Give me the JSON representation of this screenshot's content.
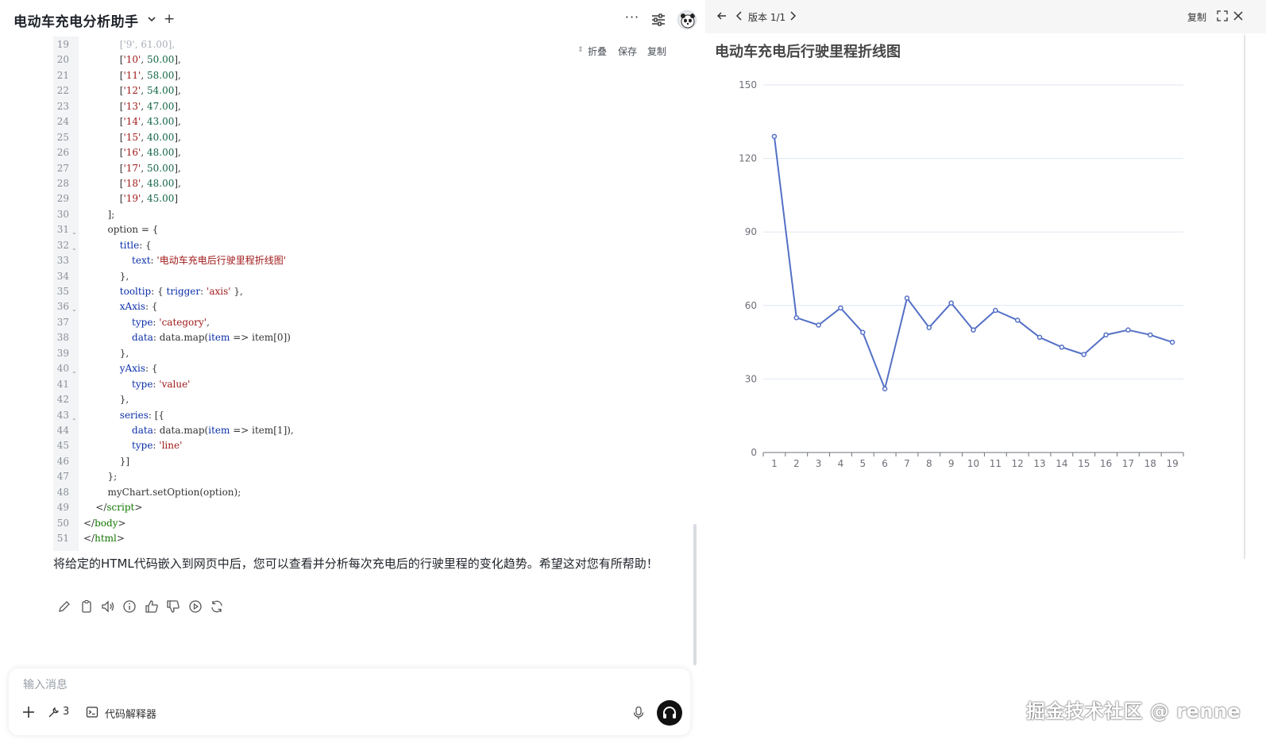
{
  "app": {
    "title": "电动车充电分析助手",
    "new_chat_label": "+",
    "more_label": "···"
  },
  "code_block": {
    "actions": {
      "fold": "折叠",
      "save": "保存",
      "copy": "复制"
    },
    "lines": [
      {
        "n": "19",
        "fold": false,
        "tokens": [
          [
            "c",
            "            ['9', 61.00],"
          ]
        ]
      },
      {
        "n": "20",
        "fold": false,
        "tokens": [
          [
            "p",
            "            ["
          ],
          [
            "s",
            "'10'"
          ],
          [
            "p",
            ", "
          ],
          [
            "n",
            "50.00"
          ],
          [
            "p",
            "],"
          ]
        ]
      },
      {
        "n": "21",
        "fold": false,
        "tokens": [
          [
            "p",
            "            ["
          ],
          [
            "s",
            "'11'"
          ],
          [
            "p",
            ", "
          ],
          [
            "n",
            "58.00"
          ],
          [
            "p",
            "],"
          ]
        ]
      },
      {
        "n": "22",
        "fold": false,
        "tokens": [
          [
            "p",
            "            ["
          ],
          [
            "s",
            "'12'"
          ],
          [
            "p",
            ", "
          ],
          [
            "n",
            "54.00"
          ],
          [
            "p",
            "],"
          ]
        ]
      },
      {
        "n": "23",
        "fold": false,
        "tokens": [
          [
            "p",
            "            ["
          ],
          [
            "s",
            "'13'"
          ],
          [
            "p",
            ", "
          ],
          [
            "n",
            "47.00"
          ],
          [
            "p",
            "],"
          ]
        ]
      },
      {
        "n": "24",
        "fold": false,
        "tokens": [
          [
            "p",
            "            ["
          ],
          [
            "s",
            "'14'"
          ],
          [
            "p",
            ", "
          ],
          [
            "n",
            "43.00"
          ],
          [
            "p",
            "],"
          ]
        ]
      },
      {
        "n": "25",
        "fold": false,
        "tokens": [
          [
            "p",
            "            ["
          ],
          [
            "s",
            "'15'"
          ],
          [
            "p",
            ", "
          ],
          [
            "n",
            "40.00"
          ],
          [
            "p",
            "],"
          ]
        ]
      },
      {
        "n": "26",
        "fold": false,
        "tokens": [
          [
            "p",
            "            ["
          ],
          [
            "s",
            "'16'"
          ],
          [
            "p",
            ", "
          ],
          [
            "n",
            "48.00"
          ],
          [
            "p",
            "],"
          ]
        ]
      },
      {
        "n": "27",
        "fold": false,
        "tokens": [
          [
            "p",
            "            ["
          ],
          [
            "s",
            "'17'"
          ],
          [
            "p",
            ", "
          ],
          [
            "n",
            "50.00"
          ],
          [
            "p",
            "],"
          ]
        ]
      },
      {
        "n": "28",
        "fold": false,
        "tokens": [
          [
            "p",
            "            ["
          ],
          [
            "s",
            "'18'"
          ],
          [
            "p",
            ", "
          ],
          [
            "n",
            "48.00"
          ],
          [
            "p",
            "],"
          ]
        ]
      },
      {
        "n": "29",
        "fold": false,
        "tokens": [
          [
            "p",
            "            ["
          ],
          [
            "s",
            "'19'"
          ],
          [
            "p",
            ", "
          ],
          [
            "n",
            "45.00"
          ],
          [
            "p",
            "]"
          ]
        ]
      },
      {
        "n": "30",
        "fold": false,
        "tokens": [
          [
            "p",
            "        ];"
          ]
        ]
      },
      {
        "n": "31",
        "fold": true,
        "tokens": [
          [
            "p",
            "        option = {"
          ]
        ]
      },
      {
        "n": "32",
        "fold": true,
        "tokens": [
          [
            "p",
            "            "
          ],
          [
            "k",
            "title"
          ],
          [
            "p",
            ": {"
          ]
        ]
      },
      {
        "n": "33",
        "fold": false,
        "tokens": [
          [
            "p",
            "                "
          ],
          [
            "k",
            "text"
          ],
          [
            "p",
            ": "
          ],
          [
            "s",
            "'电动车充电后行驶里程折线图'"
          ]
        ]
      },
      {
        "n": "34",
        "fold": false,
        "tokens": [
          [
            "p",
            "            },"
          ]
        ]
      },
      {
        "n": "35",
        "fold": false,
        "tokens": [
          [
            "p",
            "            "
          ],
          [
            "k",
            "tooltip"
          ],
          [
            "p",
            ": { "
          ],
          [
            "k",
            "trigger"
          ],
          [
            "p",
            ": "
          ],
          [
            "s",
            "'axis'"
          ],
          [
            "p",
            " },"
          ]
        ]
      },
      {
        "n": "36",
        "fold": true,
        "tokens": [
          [
            "p",
            "            "
          ],
          [
            "k",
            "xAxis"
          ],
          [
            "p",
            ": {"
          ]
        ]
      },
      {
        "n": "37",
        "fold": false,
        "tokens": [
          [
            "p",
            "                "
          ],
          [
            "k",
            "type"
          ],
          [
            "p",
            ": "
          ],
          [
            "s",
            "'category'"
          ],
          [
            "p",
            ","
          ]
        ]
      },
      {
        "n": "38",
        "fold": false,
        "tokens": [
          [
            "p",
            "                "
          ],
          [
            "k",
            "data"
          ],
          [
            "p",
            ": data.map("
          ],
          [
            "k",
            "item"
          ],
          [
            "p",
            " => item[0])"
          ]
        ]
      },
      {
        "n": "39",
        "fold": false,
        "tokens": [
          [
            "p",
            "            },"
          ]
        ]
      },
      {
        "n": "40",
        "fold": true,
        "tokens": [
          [
            "p",
            "            "
          ],
          [
            "k",
            "yAxis"
          ],
          [
            "p",
            ": {"
          ]
        ]
      },
      {
        "n": "41",
        "fold": false,
        "tokens": [
          [
            "p",
            "                "
          ],
          [
            "k",
            "type"
          ],
          [
            "p",
            ": "
          ],
          [
            "s",
            "'value'"
          ]
        ]
      },
      {
        "n": "42",
        "fold": false,
        "tokens": [
          [
            "p",
            "            },"
          ]
        ]
      },
      {
        "n": "43",
        "fold": true,
        "tokens": [
          [
            "p",
            "            "
          ],
          [
            "k",
            "series"
          ],
          [
            "p",
            ": [{"
          ]
        ]
      },
      {
        "n": "44",
        "fold": false,
        "tokens": [
          [
            "p",
            "                "
          ],
          [
            "k",
            "data"
          ],
          [
            "p",
            ": data.map("
          ],
          [
            "k",
            "item"
          ],
          [
            "p",
            " => item[1]),"
          ]
        ]
      },
      {
        "n": "45",
        "fold": false,
        "tokens": [
          [
            "p",
            "                "
          ],
          [
            "k",
            "type"
          ],
          [
            "p",
            ": "
          ],
          [
            "s",
            "'line'"
          ]
        ]
      },
      {
        "n": "46",
        "fold": false,
        "tokens": [
          [
            "p",
            "            }]"
          ]
        ]
      },
      {
        "n": "47",
        "fold": false,
        "tokens": [
          [
            "p",
            "        };"
          ]
        ]
      },
      {
        "n": "48",
        "fold": false,
        "tokens": [
          [
            "p",
            "        myChart.setOption(option);"
          ]
        ]
      },
      {
        "n": "49",
        "fold": false,
        "tokens": [
          [
            "p",
            "    </"
          ],
          [
            "t",
            "script"
          ],
          [
            "p",
            ">"
          ]
        ]
      },
      {
        "n": "50",
        "fold": false,
        "tokens": [
          [
            "p",
            "</"
          ],
          [
            "t",
            "body"
          ],
          [
            "p",
            ">"
          ]
        ]
      },
      {
        "n": "51",
        "fold": false,
        "tokens": [
          [
            "p",
            "</"
          ],
          [
            "t",
            "html"
          ],
          [
            "p",
            ">"
          ]
        ]
      }
    ]
  },
  "answer": {
    "text": "将给定的HTML代码嵌入到网页中后，您可以查看并分析每次充电后的行驶里程的变化趋势。希望这对您有所帮助！"
  },
  "message_actions": [
    "edit-icon",
    "copy-icon",
    "speaker-icon",
    "info-icon",
    "thumbs-up-icon",
    "thumbs-down-icon",
    "play-icon",
    "refresh-icon"
  ],
  "composer": {
    "placeholder": "输入消息",
    "tools_count": "3",
    "code_interpreter_label": "代码解释器"
  },
  "preview": {
    "version_label": "版本 1/1",
    "copy_label": "复制"
  },
  "chart_data": {
    "type": "line",
    "title": "电动车充电后行驶里程折线图",
    "categories": [
      "1",
      "2",
      "3",
      "4",
      "5",
      "6",
      "7",
      "8",
      "9",
      "10",
      "11",
      "12",
      "13",
      "14",
      "15",
      "16",
      "17",
      "18",
      "19"
    ],
    "series": [
      {
        "values": [
          129,
          55,
          52,
          59,
          49,
          26,
          63,
          51,
          61,
          50,
          58,
          54,
          47,
          43,
          40,
          48,
          50,
          48,
          45
        ]
      }
    ],
    "yticks": [
      0,
      30,
      60,
      90,
      120,
      150
    ],
    "ylim": [
      0,
      150
    ],
    "grid": true,
    "line_color": "#5470c6",
    "tick_color": "#6e7079",
    "grid_color": "#e0e6f1"
  },
  "watermark": "掘金技术社区 @ renne",
  "colors": {
    "accent_dark": "#111111",
    "code_keyword": "#0b2fa8",
    "code_string": "#a11a1a",
    "code_number": "#116644"
  }
}
